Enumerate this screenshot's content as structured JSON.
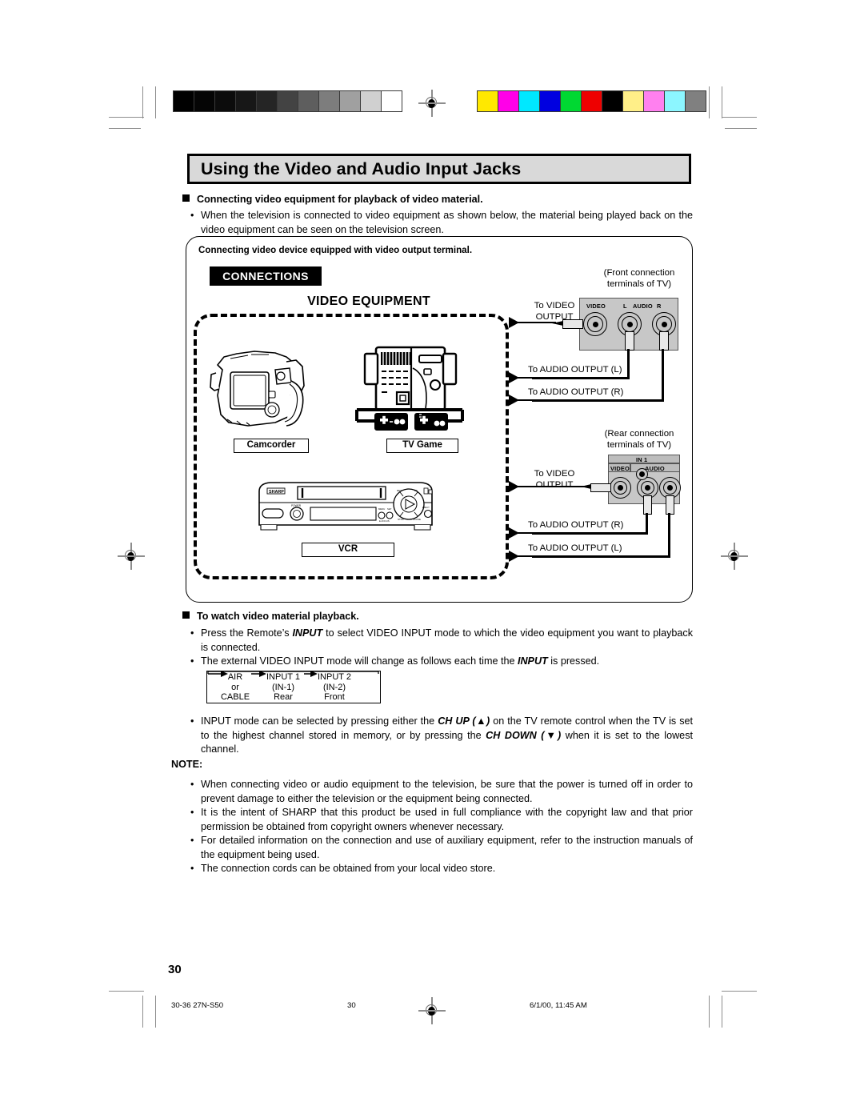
{
  "document": {
    "title": "Using the Video and Audio Input Jacks",
    "page_number": "30",
    "footer_left": "30-36 27N-S50",
    "footer_center": "30",
    "footer_right": "6/1/00, 11:45 AM"
  },
  "intro": {
    "heading": "Connecting video equipment for playback of video material.",
    "bullet": "When the television is connected to video equipment as shown below, the material being played back on the video equipment can be seen on the television screen."
  },
  "figure": {
    "caption": "Connecting video device equipped with video output terminal.",
    "connections_tag": "CONNECTIONS",
    "video_equipment_title": "VIDEO EQUIPMENT",
    "devices": [
      {
        "label": "Camcorder"
      },
      {
        "label": "TV Game"
      },
      {
        "label": "VCR"
      }
    ],
    "vcr_brand": "SHARP",
    "front_panel": {
      "caption_line1": "(Front connection",
      "caption_line2": "terminals of TV)",
      "label_video": "VIDEO",
      "label_l": "L",
      "label_audio": "AUDIO",
      "label_r": "R",
      "arrows": [
        {
          "line1": "To VIDEO",
          "line2": "OUTPUT"
        },
        {
          "line1": "To AUDIO OUTPUT (L)"
        },
        {
          "line1": "To AUDIO OUTPUT (R)"
        }
      ]
    },
    "rear_panel": {
      "caption_line1": "(Rear connection",
      "caption_line2": "terminals of TV)",
      "label_in1": "IN 1",
      "label_video": "VIDEO",
      "label_audio": "AUDIO",
      "arrows": [
        {
          "line1": "To VIDEO",
          "line2": "OUTPUT"
        },
        {
          "line1": "To AUDIO OUTPUT (R)"
        },
        {
          "line1": "To AUDIO OUTPUT (L)"
        }
      ]
    }
  },
  "playback": {
    "heading": "To watch video material playback.",
    "bullet1_pre": "Press the Remote’s ",
    "bullet1_em": "INPUT",
    "bullet1_post": " to select VIDEO INPUT mode to which the video equipment you want to playback is connected.",
    "bullet2_pre": "The external VIDEO INPUT mode will change as follows each time the ",
    "bullet2_em": "INPUT",
    "bullet2_post": " is pressed.",
    "cycle": {
      "items": [
        {
          "name": "AIR",
          "sub1": "or",
          "sub2": "CABLE"
        },
        {
          "name": "INPUT 1",
          "sub1": "(IN-1)",
          "sub2": "Rear"
        },
        {
          "name": "INPUT 2",
          "sub1": "(IN-2)",
          "sub2": "Front"
        }
      ]
    },
    "bullet3_a": "INPUT mode can be selected by pressing either the ",
    "bullet3_em1": "CH UP (▲)",
    "bullet3_b": " on the TV remote control when the TV is set to the highest channel stored in memory, or by pressing the ",
    "bullet3_em2": "CH DOWN (▼)",
    "bullet3_c": " when it is set to the lowest channel."
  },
  "note": {
    "heading": "NOTE:",
    "items": [
      "When connecting video or audio equipment to the television, be sure that the power is turned off in order to prevent damage to either the television or the equipment being connected.",
      "It is the intent of SHARP that this product be used in full compliance with the copyright law and that prior permission be obtained from copyright owners whenever necessary.",
      "For detailed information on the connection and use of auxiliary equipment, refer to the instruction manuals of the equipment being used.",
      "The connection cords can be obtained from your local video store."
    ]
  },
  "print_marks": {
    "grayscale_steps": [
      "#000000",
      "#050505",
      "#0c0c0c",
      "#171717",
      "#252525",
      "#434343",
      "#5e5e5e",
      "#7d7d7d",
      "#a0a0a0",
      "#d0d0d0",
      "#ffffff"
    ],
    "color_bar": [
      "#ffe800",
      "#ff00e8",
      "#00e8ff",
      "#0000e0",
      "#00d832",
      "#ee0000",
      "#000000",
      "#ffef88",
      "#ff80ef",
      "#8cf6ff",
      "#808080"
    ]
  }
}
